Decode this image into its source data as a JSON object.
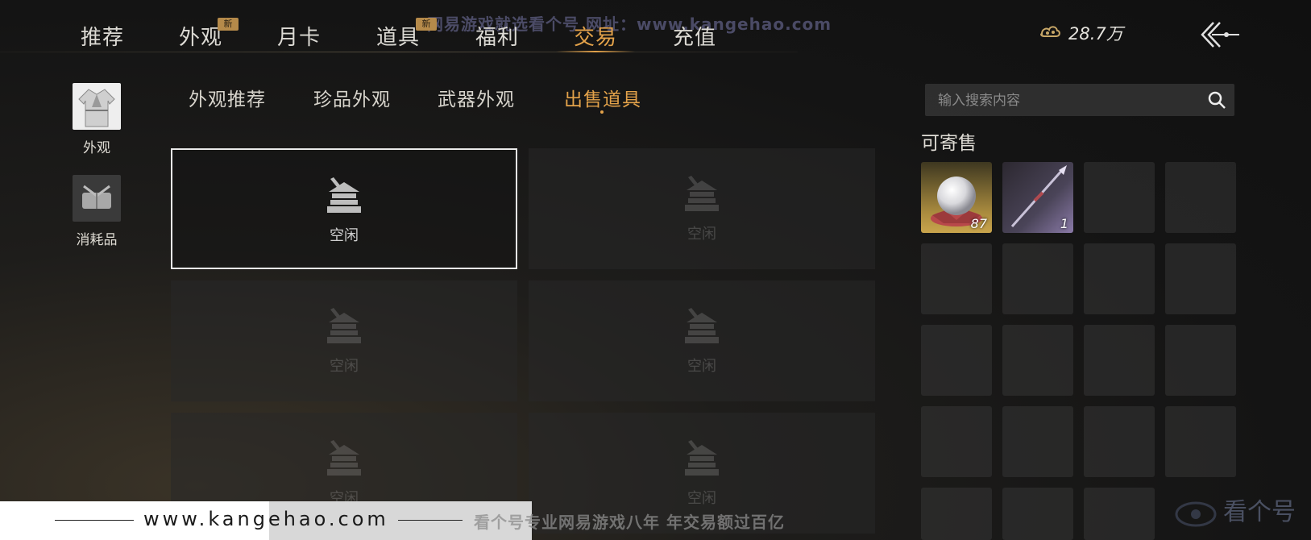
{
  "watermark": {
    "top_text": "网易游戏就选看个号  网址：www.kangehao.com",
    "bottom_url": "www.kangehao.com",
    "bottom_slogan": "看个号专业网易游戏八年  年交易额过百亿",
    "corner_logo_text": "看个号"
  },
  "nav": {
    "tabs": [
      {
        "label": "推荐"
      },
      {
        "label": "外观",
        "badge": "新"
      },
      {
        "label": "月卡"
      },
      {
        "label": "道具",
        "badge": "新"
      },
      {
        "label": "福利"
      },
      {
        "label": "交易",
        "active": true
      },
      {
        "label": "充值"
      }
    ],
    "currency": "28.7万",
    "currency_icon": "coin-cloud-icon",
    "back_icon": "back-arrow-icon"
  },
  "categories": [
    {
      "label": "外观",
      "icon": "robe-icon",
      "active": true
    },
    {
      "label": "消耗品",
      "icon": "package-icon"
    }
  ],
  "subtabs": [
    {
      "label": "外观推荐"
    },
    {
      "label": "珍品外观"
    },
    {
      "label": "武器外观"
    },
    {
      "label": "出售道具",
      "active": true
    }
  ],
  "slots": [
    {
      "label": "空闲",
      "selected": true
    },
    {
      "label": "空闲"
    },
    {
      "label": "空闲"
    },
    {
      "label": "空闲"
    },
    {
      "label": "空闲"
    },
    {
      "label": "空闲"
    }
  ],
  "search": {
    "placeholder": "输入搜索内容"
  },
  "sellable": {
    "title": "可寄售",
    "items": [
      {
        "icon": "pearl-icon",
        "count": "87"
      },
      {
        "icon": "spear-icon",
        "count": "1"
      }
    ]
  },
  "colors": {
    "accent": "#e3a24a",
    "background": "#141414"
  }
}
